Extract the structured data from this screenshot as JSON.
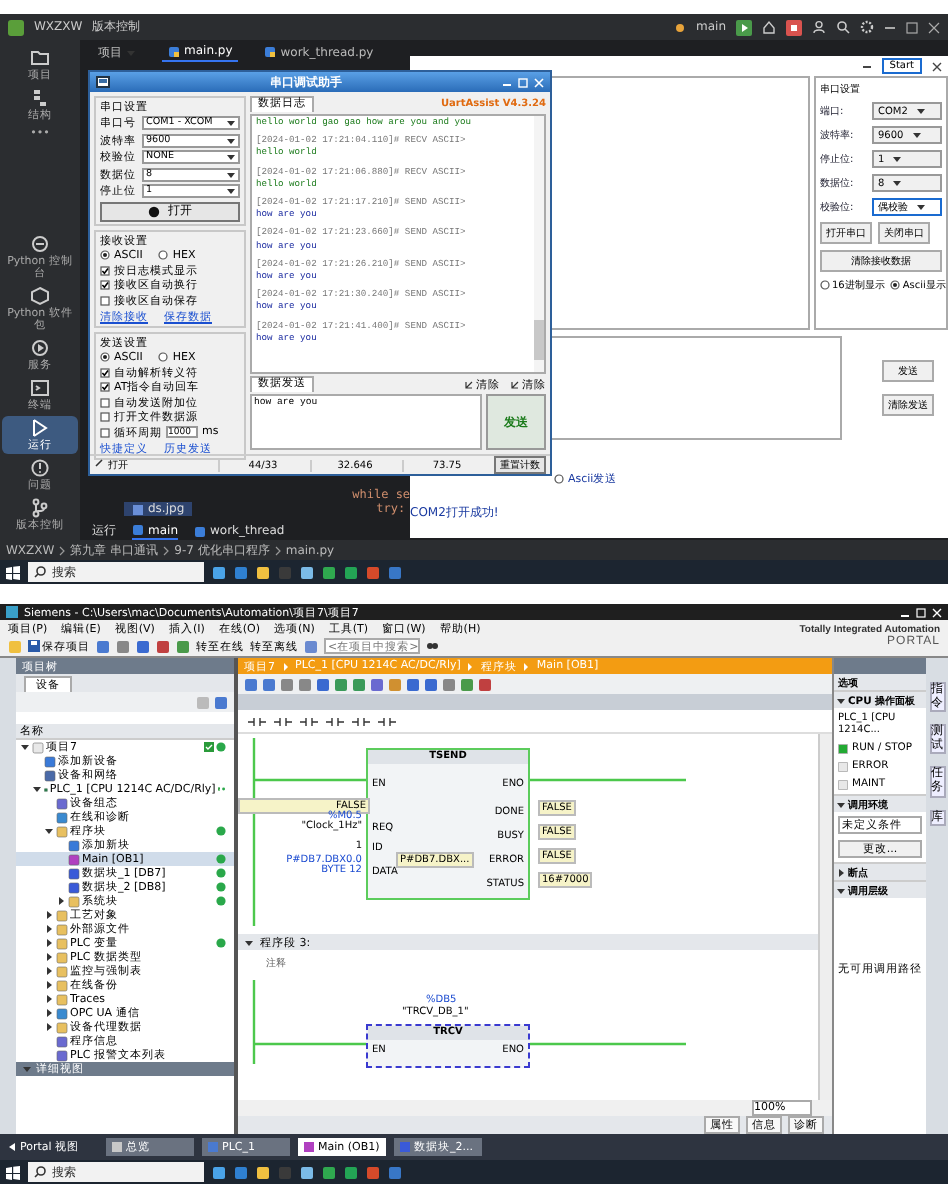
{
  "ide": {
    "app_name": "WXZXW",
    "vcs_menu": "版本控制",
    "branch": "main",
    "activity_top": [
      {
        "label": "项目",
        "kind": "folder",
        "selected": false
      },
      {
        "label": "结构",
        "kind": "structure",
        "selected": false
      },
      {
        "label": "•••",
        "kind": "more",
        "selected": false
      }
    ],
    "activity_bottom": [
      {
        "label": "Python 控制台",
        "kind": "console",
        "selected": false
      },
      {
        "label": "Python 软件包",
        "kind": "package",
        "selected": false
      },
      {
        "label": "服务",
        "kind": "services",
        "selected": false
      },
      {
        "label": "终端",
        "kind": "terminal",
        "selected": false
      },
      {
        "label": "运行",
        "kind": "run",
        "selected": true
      },
      {
        "label": "问题",
        "kind": "problems",
        "selected": false
      },
      {
        "label": "版本控制",
        "kind": "vcs",
        "selected": false
      }
    ],
    "project_menu": "项目",
    "editor_tabs": [
      {
        "label": "main.py",
        "selected": true
      },
      {
        "label": "work_thread.py",
        "selected": false
      }
    ],
    "file_item": "ds.jpg",
    "code": [
      {
        "text": "while se",
        "children": [
          {
            "text": "try:"
          }
        ]
      }
    ],
    "run_bar": {
      "label": "运行",
      "tabs": [
        {
          "label": "main",
          "selected": true
        },
        {
          "label": "work_thread",
          "selected": false
        }
      ]
    },
    "breadcrumb": [
      "WXZXW",
      "第九章 串口通讯",
      "9-7 优化串口程序",
      "main.py"
    ],
    "serial_assistant": {
      "title": "串口调试助手",
      "port_group": {
        "title": "串口设置",
        "fields": [
          {
            "label": "串口号",
            "value": "COM1 - XCOM"
          },
          {
            "label": "波特率",
            "value": "9600"
          },
          {
            "label": "校验位",
            "value": "NONE"
          },
          {
            "label": "数据位",
            "value": "8"
          },
          {
            "label": "停止位",
            "value": "1"
          }
        ],
        "open_button": "打开"
      },
      "receive_group": {
        "title": "接收设置",
        "modes": [
          {
            "label": "ASCII",
            "selected": true
          },
          {
            "label": "HEX",
            "selected": false
          }
        ],
        "options": [
          {
            "kind": "plain",
            "label": "按日志模式显示",
            "checked": true
          },
          {
            "kind": "plain",
            "label": "接收区自动换行",
            "checked": true
          },
          {
            "kind": "plain",
            "label": "接收区自动保存",
            "checked": false
          }
        ],
        "links": [
          "清除接收",
          "保存数据"
        ]
      },
      "send_group": {
        "title": "发送设置",
        "modes": [
          {
            "label": "ASCII",
            "selected": true
          },
          {
            "label": "HEX",
            "selected": false
          }
        ],
        "options": [
          {
            "kind": "plain",
            "label": "自动解析转义符",
            "checked": true
          },
          {
            "kind": "plain",
            "label": "AT指令自动回车",
            "checked": true
          },
          {
            "kind": "plain",
            "label": "自动发送附加位",
            "checked": false
          },
          {
            "kind": "plain",
            "label": "打开文件数据源",
            "checked": false
          },
          {
            "kind": "period",
            "label": "循环周期",
            "value": "1000",
            "unit": "ms",
            "checked": false
          }
        ],
        "links": [
          "快捷定义",
          "历史发送"
        ]
      },
      "log_tab": "数据日志",
      "brand": "UartAssist V4.3.24",
      "log": [
        {
          "kind": "recv",
          "text": "hello world gao gao how are you and you"
        },
        {
          "kind": "header",
          "text": "[2024-01-02 17:21:04.110]# RECV ASCII>"
        },
        {
          "kind": "recv",
          "text": "hello world"
        },
        {
          "kind": "header",
          "text": "[2024-01-02 17:21:06.880]# RECV ASCII>"
        },
        {
          "kind": "recv",
          "text": "hello world"
        },
        {
          "kind": "header",
          "text": "[2024-01-02 17:21:17.210]# SEND ASCII>"
        },
        {
          "kind": "send",
          "text": "how are you"
        },
        {
          "kind": "header",
          "text": "[2024-01-02 17:21:23.660]# SEND ASCII>"
        },
        {
          "kind": "send",
          "text": "how are you"
        },
        {
          "kind": "header",
          "text": "[2024-01-02 17:21:26.210]# SEND ASCII>"
        },
        {
          "kind": "send",
          "text": "how are you"
        },
        {
          "kind": "header",
          "text": "[2024-01-02 17:21:30.240]# SEND ASCII>"
        },
        {
          "kind": "send",
          "text": "how are you"
        },
        {
          "kind": "header",
          "text": "[2024-01-02 17:21:41.400]# SEND ASCII>"
        },
        {
          "kind": "send",
          "text": "how are you"
        }
      ],
      "send_tab": "数据发送",
      "clear_buttons": [
        "清除",
        "清除"
      ],
      "send_text": "how are you",
      "send_button": "发送",
      "status": {
        "port_state": "打开",
        "counts": [
          "44/33",
          "32.646",
          "73.75"
        ],
        "reset_button": "重置计数"
      }
    },
    "py_app": {
      "start_button": "Start",
      "settings": {
        "title": "串口设置",
        "fields": [
          {
            "label": "端口:",
            "value": "COM2"
          },
          {
            "label": "波特率:",
            "value": "9600"
          },
          {
            "label": "停止位:",
            "value": "1"
          },
          {
            "label": "数据位:",
            "value": "8"
          },
          {
            "label": "校验位:",
            "value": "偶校验"
          }
        ],
        "open_button": "打开串口",
        "close_button": "关闭串口",
        "clear_button": "清除接收数据",
        "display_modes": [
          {
            "label": "16进制显示",
            "selected": false
          },
          {
            "label": "Ascii显示",
            "selected": true
          }
        ]
      },
      "send_button": "发送",
      "clear_send_button": "清除发送",
      "send_mode": {
        "label": "Ascii发送",
        "selected": false
      },
      "status": "COM2打开成功!"
    },
    "taskbar": {
      "search": "搜索"
    }
  },
  "tia": {
    "title": "Siemens - C:\\Users\\mac\\Documents\\Automation\\项目7\\项目7",
    "menu": [
      "项目(P)",
      "编辑(E)",
      "视图(V)",
      "插入(I)",
      "在线(O)",
      "选项(N)",
      "工具(T)",
      "窗口(W)",
      "帮助(H)"
    ],
    "toolbar": {
      "save": "保存项目",
      "go_online": "转至在线",
      "go_offline": "转至离线",
      "search_placeholder": "<在项目中搜索>"
    },
    "brand": [
      "Totally Integrated Automation",
      "PORTAL"
    ],
    "project_tree": {
      "title": "项目树",
      "tab": "设备",
      "column": "名称",
      "detail_view": "详细视图",
      "items": [
        {
          "label": "项目7",
          "kind": "project",
          "expanded": true,
          "selected": false,
          "config_ok": true,
          "online_ok": true,
          "children": [
            {
              "label": "添加新设备",
              "kind": "add",
              "selected": false,
              "config_ok": false,
              "online_ok": false
            },
            {
              "label": "设备和网络",
              "kind": "network",
              "selected": false,
              "config_ok": false,
              "online_ok": false
            },
            {
              "label": "PLC_1 [CPU 1214C AC/DC/Rly]",
              "kind": "plc",
              "expanded": true,
              "selected": false,
              "config_ok": true,
              "online_ok": true,
              "children": [
                {
                  "label": "设备组态",
                  "kind": "config",
                  "selected": false,
                  "config_ok": false,
                  "online_ok": false
                },
                {
                  "label": "在线和诊断",
                  "kind": "diag",
                  "selected": false,
                  "config_ok": false,
                  "online_ok": false
                },
                {
                  "label": "程序块",
                  "kind": "folder",
                  "expanded": true,
                  "selected": false,
                  "config_ok": false,
                  "online_ok": true,
                  "children": [
                    {
                      "label": "添加新块",
                      "kind": "add",
                      "selected": false,
                      "config_ok": false,
                      "online_ok": false
                    },
                    {
                      "label": "Main [OB1]",
                      "kind": "ob",
                      "selected": true,
                      "config_ok": false,
                      "online_ok": true
                    },
                    {
                      "label": "数据块_1 [DB7]",
                      "kind": "db",
                      "selected": false,
                      "config_ok": false,
                      "online_ok": true
                    },
                    {
                      "label": "数据块_2 [DB8]",
                      "kind": "db",
                      "selected": false,
                      "config_ok": false,
                      "online_ok": true
                    },
                    {
                      "label": "系统块",
                      "kind": "folder",
                      "expanded": false,
                      "selected": false,
                      "config_ok": false,
                      "online_ok": true
                    }
                  ]
                },
                {
                  "label": "工艺对象",
                  "kind": "folder",
                  "expanded": false,
                  "selected": false,
                  "config_ok": false,
                  "online_ok": false
                },
                {
                  "label": "外部源文件",
                  "kind": "folder",
                  "expanded": false,
                  "selected": false,
                  "config_ok": false,
                  "online_ok": false
                },
                {
                  "label": "PLC 变量",
                  "kind": "folder",
                  "expanded": false,
                  "selected": false,
                  "config_ok": false,
                  "online_ok": true
                },
                {
                  "label": "PLC 数据类型",
                  "kind": "folder",
                  "expanded": false,
                  "selected": false,
                  "config_ok": false,
                  "online_ok": false
                },
                {
                  "label": "监控与强制表",
                  "kind": "folder",
                  "expanded": false,
                  "selected": false,
                  "config_ok": false,
                  "online_ok": false
                },
                {
                  "label": "在线备份",
                  "kind": "folder",
                  "expanded": false,
                  "selected": false,
                  "config_ok": false,
                  "online_ok": false
                },
                {
                  "label": "Traces",
                  "kind": "folder",
                  "expanded": false,
                  "selected": false,
                  "config_ok": false,
                  "online_ok": false
                },
                {
                  "label": "OPC UA 通信",
                  "kind": "diag",
                  "expanded": false,
                  "selected": false,
                  "config_ok": false,
                  "online_ok": false
                },
                {
                  "label": "设备代理数据",
                  "kind": "folder",
                  "expanded": false,
                  "selected": false,
                  "config_ok": false,
                  "online_ok": false
                },
                {
                  "label": "程序信息",
                  "kind": "config",
                  "selected": false,
                  "config_ok": false,
                  "online_ok": false
                },
                {
                  "label": "PLC 报警文本列表",
                  "kind": "config",
                  "selected": false,
                  "config_ok": false,
                  "online_ok": false
                }
              ]
            }
          ]
        }
      ]
    },
    "editor": {
      "breadcrumb": [
        "项目7",
        "PLC_1 [CPU 1214C AC/DC/Rly]",
        "程序块",
        "Main [OB1]"
      ],
      "block1": {
        "type": "TSEND",
        "inputs": [
          {
            "pin": "EN"
          },
          {
            "pin": "REQ",
            "values": [
              "FALSE",
              "%M0.5",
              "\"Clock_1Hz\""
            ]
          },
          {
            "pin": "ID",
            "values": [
              "1"
            ]
          },
          {
            "pin": "DATA",
            "values": [
              "P#DB7.DBX0.0",
              "BYTE 12"
            ],
            "monitor": "P#DB7.DBX..."
          }
        ],
        "outputs": [
          {
            "pin": "ENO"
          },
          {
            "pin": "DONE",
            "value": "FALSE"
          },
          {
            "pin": "BUSY",
            "value": "FALSE"
          },
          {
            "pin": "ERROR",
            "value": "FALSE"
          },
          {
            "pin": "STATUS",
            "value": "16#7000"
          }
        ]
      },
      "network": {
        "title": "程序段 3:",
        "comment": "注释",
        "expanded": true
      },
      "block2": {
        "address": "%DB5",
        "instance": "\"TRCV_DB_1\"",
        "type": "TRCV",
        "inputs": [
          {
            "pin": "EN"
          }
        ],
        "outputs": [
          {
            "pin": "ENO"
          }
        ]
      },
      "zoom": "100%",
      "inspector_tabs": [
        "属性",
        "信息",
        "诊断"
      ]
    },
    "task_pane": {
      "title": "选项",
      "sections": [
        {
          "kind": "cpu",
          "title": "CPU 操作面板",
          "expanded": true,
          "device": "PLC_1 [CPU 1214C...",
          "leds": [
            {
              "label": "RUN / STOP",
              "on": true
            },
            {
              "label": "ERROR",
              "on": false
            },
            {
              "label": "MAINT",
              "on": false
            }
          ]
        },
        {
          "kind": "env",
          "title": "调用环境",
          "expanded": true,
          "condition": "未定义条件",
          "button": "更改..."
        },
        {
          "kind": "plain",
          "title": "断点",
          "expanded": false
        },
        {
          "kind": "hier",
          "title": "调用层级",
          "expanded": true,
          "empty": "无可用调用路径"
        }
      ]
    },
    "side_tabs": [
      "指令",
      "测试",
      "任务",
      "库"
    ],
    "portal_bar": {
      "portal_view": "Portal 视图",
      "tabs": [
        {
          "label": "总览",
          "kind": "overview",
          "selected": false
        },
        {
          "label": "PLC_1",
          "kind": "device",
          "selected": false
        },
        {
          "label": "Main (OB1)",
          "kind": "block",
          "selected": true
        },
        {
          "label": "数据块_2...",
          "kind": "data",
          "selected": false
        }
      ]
    },
    "taskbar": {
      "search": "搜索"
    }
  }
}
